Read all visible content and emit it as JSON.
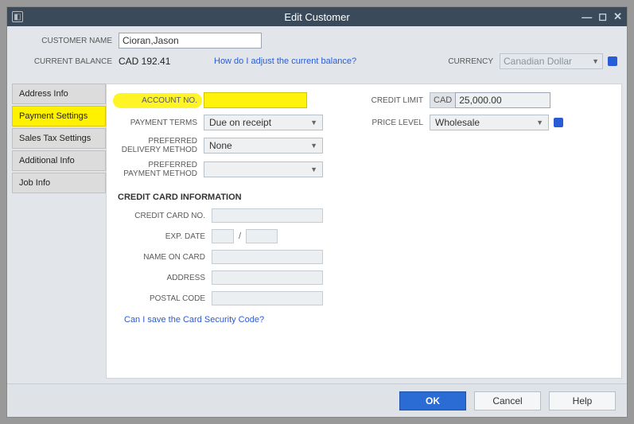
{
  "window": {
    "title": "Edit Customer"
  },
  "header": {
    "customer_name_label": "CUSTOMER NAME",
    "customer_name_value": "Cioran,Jason",
    "current_balance_label": "CURRENT BALANCE",
    "current_balance_value": "CAD 192.41",
    "adjust_link": "How do I adjust the current balance?",
    "currency_label": "CURRENCY",
    "currency_value": "Canadian Dollar"
  },
  "tabs": [
    {
      "label": "Address Info"
    },
    {
      "label": "Payment Settings"
    },
    {
      "label": "Sales Tax Settings"
    },
    {
      "label": "Additional Info"
    },
    {
      "label": "Job Info"
    }
  ],
  "payment": {
    "account_no_label": "ACCOUNT NO.",
    "payment_terms_label": "PAYMENT TERMS",
    "payment_terms_value": "Due on receipt",
    "delivery_method_label": "PREFERRED DELIVERY METHOD",
    "delivery_method_value": "None",
    "payment_method_label": "PREFERRED PAYMENT METHOD",
    "credit_limit_label": "CREDIT LIMIT",
    "credit_limit_prefix": "CAD",
    "credit_limit_value": "25,000.00",
    "price_level_label": "PRICE LEVEL",
    "price_level_value": "Wholesale"
  },
  "cc": {
    "title": "CREDIT CARD INFORMATION",
    "card_no_label": "CREDIT CARD NO.",
    "exp_date_label": "EXP. DATE",
    "exp_sep": "/",
    "name_label": "NAME ON CARD",
    "address_label": "ADDRESS",
    "postal_label": "POSTAL CODE",
    "security_link": "Can I save the Card Security Code?"
  },
  "footer": {
    "ok": "OK",
    "cancel": "Cancel",
    "help": "Help"
  }
}
